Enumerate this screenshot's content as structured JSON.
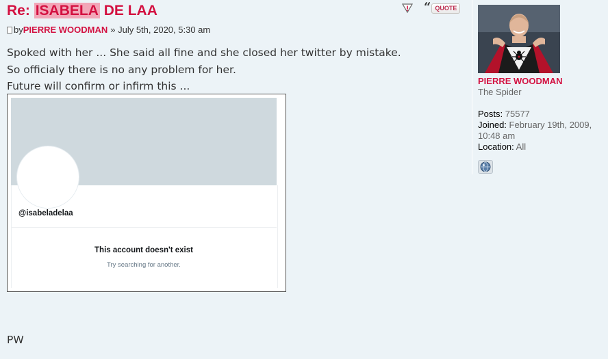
{
  "post": {
    "title_prefix": "Re: ",
    "title_highlight": "ISABELA",
    "title_suffix": " DE LAA",
    "by_label": "by",
    "author": "PIERRE WOODMAN",
    "date_sep": "»",
    "date": "July 5th, 2020, 5:30 am",
    "quote_label": "QUOTE",
    "lines": [
      "Spoked with her ... She said all fine and she closed her twitter by mistake.",
      "So officialy there is no any problem for her.",
      "Future will confirm or infirm this ..."
    ],
    "signature": "PW"
  },
  "embedded_screenshot": {
    "handle": "@isabeladelaa",
    "message": "This account doesn't exist",
    "submessage": "Try searching for another."
  },
  "profile": {
    "username": "PIERRE WOODMAN",
    "rank": "The Spider",
    "posts_label": "Posts:",
    "posts_value": "75577",
    "joined_label": "Joined:",
    "joined_value_1": "February 19th, 2009,",
    "joined_value_2": "10:48 am",
    "location_label": "Location:",
    "location_value": "All"
  },
  "icons": {
    "report": "report-icon",
    "quote": "quote-icon",
    "post": "post-icon",
    "website": "website-icon"
  },
  "colors": {
    "accent": "#d31141",
    "background": "#ecf3f7",
    "highlight": "#f2a6b8"
  }
}
